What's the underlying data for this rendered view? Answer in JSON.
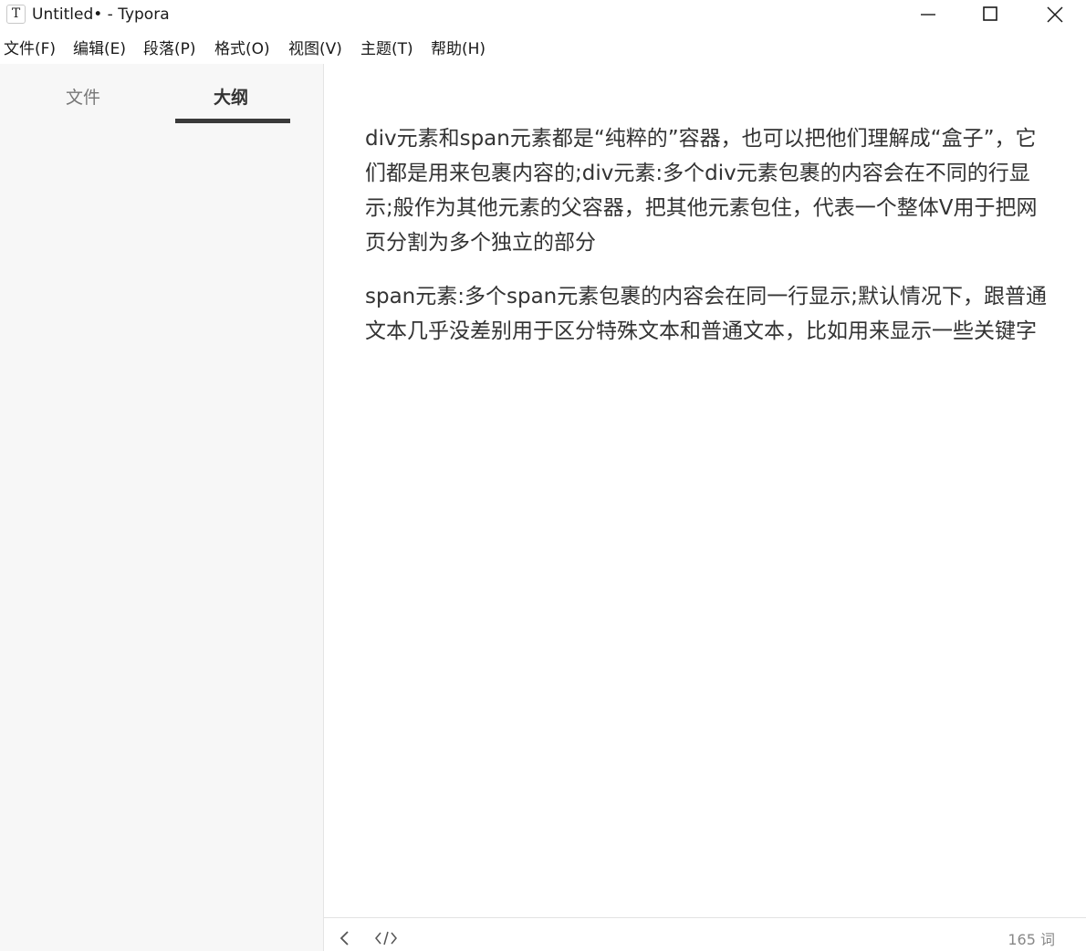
{
  "window": {
    "icon_letter": "T",
    "title": "Untitled• - Typora"
  },
  "menu": [
    {
      "label": "文件(F)"
    },
    {
      "label": "编辑(E)"
    },
    {
      "label": "段落(P)"
    },
    {
      "label": "格式(O)"
    },
    {
      "label": "视图(V)"
    },
    {
      "label": "主题(T)"
    },
    {
      "label": "帮助(H)"
    }
  ],
  "sidebar": {
    "tabs": [
      {
        "label": "文件",
        "active": false
      },
      {
        "label": "大纲",
        "active": true
      }
    ]
  },
  "editor": {
    "paragraphs": [
      "div元素和span元素都是“纯粹的”容器，也可以把他们理解成“盒子”，它们都是用来包裹内容的;div元素:多个div元素包裹的内容会在不同的行显示;般作为其他元素的父容器，把其他元素包住，代表一个整体V用于把网页分割为多个独立的部分",
      "span元素:多个span元素包裹的内容会在同一行显示;默认情况下，跟普通文本几乎没差别用于区分特殊文本和普通文本，比如用来显示一些关键字"
    ]
  },
  "footer": {
    "word_count": "165 词",
    "back_icon": "chevron-left-icon",
    "source_icon": "code-icon"
  },
  "colors": {
    "sidebar_bg": "#f7f7f7",
    "text": "#333333",
    "tab_indicator": "#3a3a3a"
  }
}
